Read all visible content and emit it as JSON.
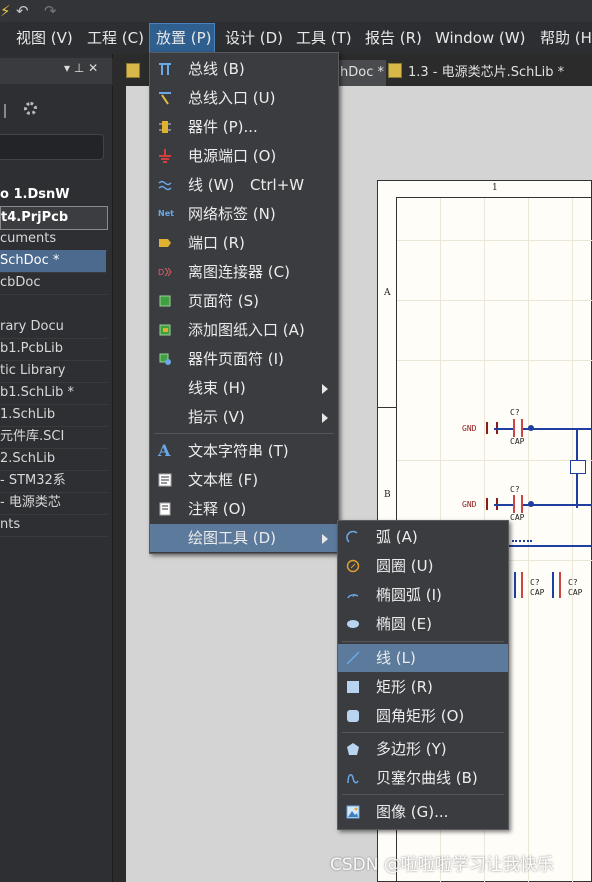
{
  "toolbar": {
    "undo_icon": "undo-icon",
    "redo_icon": "redo-icon"
  },
  "menubar": {
    "items": [
      "视图 (V)",
      "工程 (C)",
      "放置 (P)",
      "设计 (D)",
      "工具 (T)",
      "报告 (R)",
      "Window (W)",
      "帮助 (H)"
    ],
    "active_index": 2
  },
  "left_panel": {
    "pin": "▾  ⊥  ✕",
    "rows": [
      "o 1.DsnW",
      "t4.PrjPcb",
      "cuments",
      "SchDoc *",
      "cbDoc",
      "rary Docu",
      "b1.PcbLib",
      "tic Library",
      "b1.SchLib *",
      "1.SchLib",
      "元件库.SCI",
      "2.SchLib",
      "- STM32系",
      "- 电源类芯",
      "nts"
    ]
  },
  "tabs": [
    {
      "label": "hDoc *"
    },
    {
      "label": "1.3  - 电源类芯片.SchLib *"
    }
  ],
  "place_menu": {
    "items": [
      {
        "label": "总线 (B)",
        "icon": "bus-icon"
      },
      {
        "label": "总线入口 (U)",
        "icon": "bus-entry-icon"
      },
      {
        "label": "器件 (P)...",
        "icon": "part-icon"
      },
      {
        "label": "电源端口 (O)",
        "icon": "power-port-icon"
      },
      {
        "label": "线 (W)",
        "shortcut": "Ctrl+W",
        "icon": "wire-icon"
      },
      {
        "label": "网络标签 (N)",
        "icon": "net-label-icon"
      },
      {
        "label": "端口 (R)",
        "icon": "port-icon"
      },
      {
        "label": "离图连接器 (C)",
        "icon": "off-sheet-connector-icon"
      },
      {
        "label": "页面符 (S)",
        "icon": "sheet-symbol-icon"
      },
      {
        "label": "添加图纸入口 (A)",
        "icon": "sheet-entry-icon"
      },
      {
        "label": "器件页面符 (I)",
        "icon": "device-sheet-icon"
      },
      {
        "label": "线束 (H)",
        "icon": "",
        "submenu": true
      },
      {
        "label": "指示 (V)",
        "icon": "",
        "submenu": true
      },
      {
        "label": "文本字符串 (T)",
        "icon": "text-string-icon"
      },
      {
        "label": "文本框 (F)",
        "icon": "text-frame-icon"
      },
      {
        "label": "注释 (O)",
        "icon": "note-icon"
      },
      {
        "label": "绘图工具 (D)",
        "icon": "",
        "submenu": true,
        "highlighted": true
      }
    ]
  },
  "drawing_tools_menu": {
    "items": [
      {
        "label": "弧 (A)",
        "icon": "arc-icon"
      },
      {
        "label": "圆圈 (U)",
        "icon": "full-circle-icon"
      },
      {
        "label": "椭圆弧 (I)",
        "icon": "elliptical-arc-icon"
      },
      {
        "label": "椭圆 (E)",
        "icon": "ellipse-icon"
      },
      {
        "label": "线 (L)",
        "icon": "line-icon",
        "highlighted": true
      },
      {
        "label": "矩形 (R)",
        "icon": "rectangle-icon"
      },
      {
        "label": "圆角矩形 (O)",
        "icon": "round-rectangle-icon"
      },
      {
        "label": "多边形 (Y)",
        "icon": "polygon-icon"
      },
      {
        "label": "贝塞尔曲线 (B)",
        "icon": "bezier-icon"
      },
      {
        "label": "图像 (G)...",
        "icon": "image-icon"
      }
    ]
  },
  "schematic": {
    "col_label": "1",
    "row_a": "A",
    "row_b": "B",
    "gnd1": "GND",
    "cap1_ref": "C?",
    "cap1_val": "CAP",
    "gnd2": "GND",
    "cap2_ref": "C?",
    "cap2_val": "CAP",
    "cap3_ref": "C?",
    "cap3_val": "CAP",
    "cap4_ref": "C?",
    "cap4_val": "CAP"
  },
  "watermark": "CSDN @啦啦啦学习让我快乐",
  "colors": {
    "menu_active": "#2f5f8f",
    "highlight": "#5c7a9c",
    "wire": "#1f3fa0"
  }
}
